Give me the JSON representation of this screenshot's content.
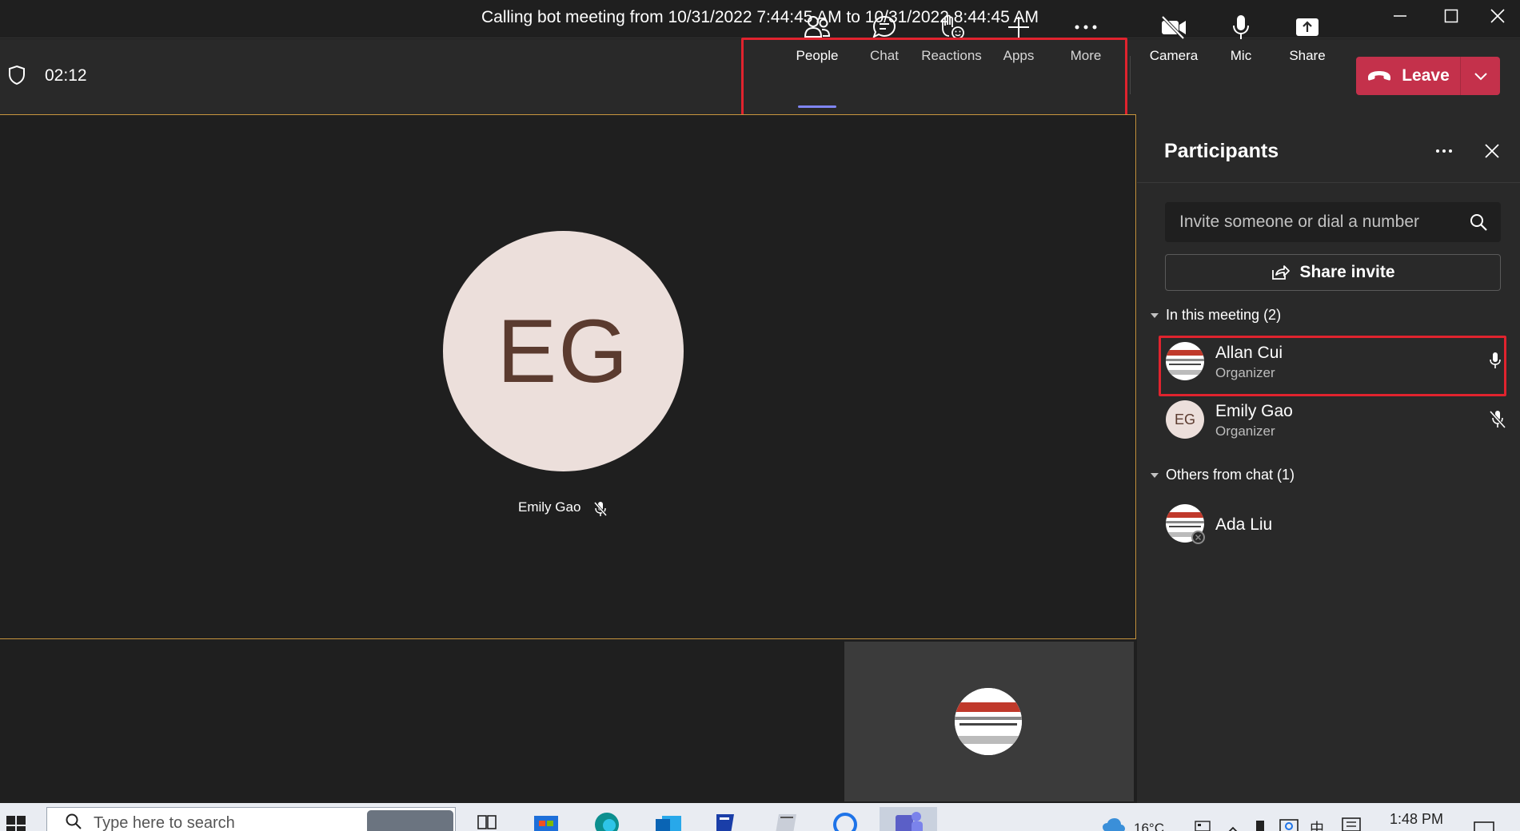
{
  "window": {
    "title": "Calling bot meeting from 10/31/2022 7:44:45 AM to 10/31/2022 8:44:45 AM"
  },
  "toolbar": {
    "timer": "02:12",
    "buttons": [
      {
        "label": "People",
        "icon": "people-icon",
        "active": true
      },
      {
        "label": "Chat",
        "icon": "chat-icon"
      },
      {
        "label": "Reactions",
        "icon": "reactions-icon"
      },
      {
        "label": "Apps",
        "icon": "plus-icon"
      },
      {
        "label": "More",
        "icon": "more-icon"
      },
      {
        "label": "Camera",
        "icon": "camera-off-icon"
      },
      {
        "label": "Mic",
        "icon": "mic-icon"
      },
      {
        "label": "Share",
        "icon": "share-icon"
      }
    ],
    "leave_label": "Leave",
    "accent_color": "#7f85f5",
    "leave_color": "#c4314b"
  },
  "stage": {
    "avatar_initials": "EG",
    "participant_name": "Emily Gao"
  },
  "panel": {
    "title": "Participants",
    "search_placeholder": "Invite someone or dial a number",
    "share_invite_label": "Share invite",
    "sections": [
      {
        "label": "In this meeting (2)",
        "people": [
          {
            "name": "Allan Cui",
            "role": "Organizer",
            "mic": "on"
          },
          {
            "name": "Emily Gao",
            "role": "Organizer",
            "initials": "EG",
            "mic": "muted"
          }
        ]
      },
      {
        "label": "Others from chat (1)",
        "people": [
          {
            "name": "Ada Liu",
            "status": "offline"
          }
        ]
      }
    ]
  },
  "taskbar": {
    "search_placeholder": "Type here to search",
    "temperature": "16°C",
    "ime_1": "中",
    "time": "1:48 PM"
  }
}
